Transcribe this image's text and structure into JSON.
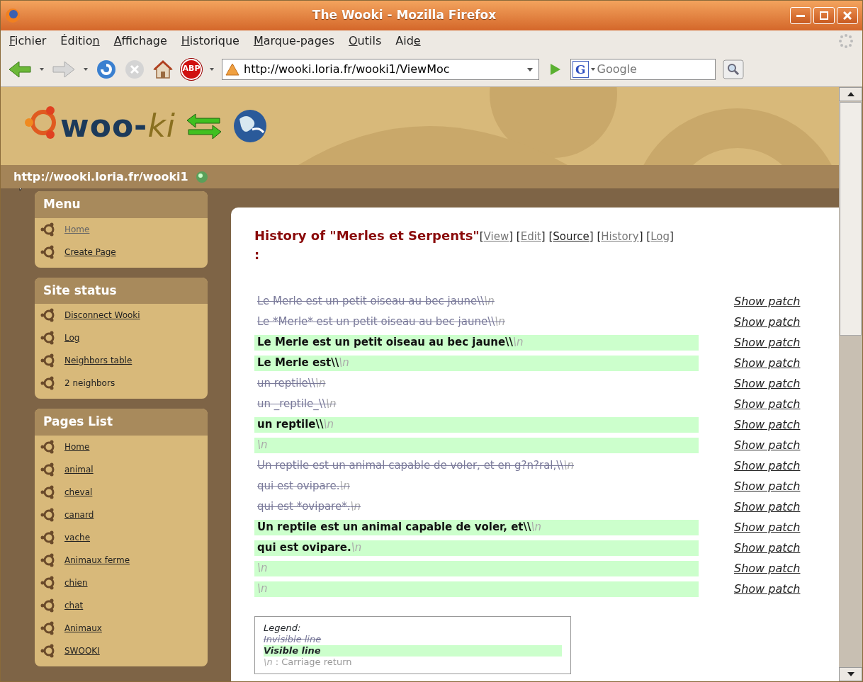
{
  "window": {
    "title": "The Wooki - Mozilla Firefox"
  },
  "menu_bar": [
    {
      "key": "F",
      "after": "ichier"
    },
    {
      "before": "Éditio",
      "key": "n"
    },
    {
      "key": "A",
      "after": "ffichage"
    },
    {
      "key": "H",
      "after": "istorique"
    },
    {
      "key": "M",
      "after": "arque-pages"
    },
    {
      "key": "O",
      "after": "utils"
    },
    {
      "before": "Aid",
      "key": "e"
    }
  ],
  "toolbar": {
    "adblock_label": "ABP",
    "url": "http://wooki.loria.fr/wooki1/ViewMoc",
    "search_engine_letter": "G",
    "search_placeholder": "Google"
  },
  "site": {
    "logo": [
      "woo-",
      "ki"
    ],
    "url": "http://wooki.loria.fr/wooki1"
  },
  "sidebar": [
    {
      "title": "Menu",
      "items": [
        {
          "label": "Home",
          "link": true,
          "visited": true
        },
        {
          "label": "Create Page",
          "link": true,
          "visited": false
        }
      ]
    },
    {
      "title": "Site status",
      "items": [
        {
          "label": "Disconnect Wooki",
          "link": true,
          "visited": false
        },
        {
          "label": "Log",
          "link": true,
          "visited": false
        },
        {
          "label": "Neighbors table",
          "link": true,
          "visited": false
        },
        {
          "label": "2 neighbors",
          "link": false,
          "visited": false
        }
      ]
    },
    {
      "title": "Pages List",
      "items": [
        {
          "label": "Home",
          "link": true,
          "visited": false
        },
        {
          "label": "animal",
          "link": true,
          "visited": false
        },
        {
          "label": "cheval",
          "link": true,
          "visited": false
        },
        {
          "label": "canard",
          "link": true,
          "visited": false
        },
        {
          "label": "vache",
          "link": true,
          "visited": false
        },
        {
          "label": "Animaux ferme",
          "link": true,
          "visited": false
        },
        {
          "label": "chien",
          "link": true,
          "visited": false
        },
        {
          "label": "chat",
          "link": true,
          "visited": false
        },
        {
          "label": "Animaux",
          "link": true,
          "visited": false
        },
        {
          "label": "SWOOKI",
          "link": true,
          "visited": false
        }
      ]
    }
  ],
  "page": {
    "title": "History of \"Merles et Serpents\"",
    "title_suffix": ":",
    "actions": [
      {
        "before": "[",
        "label": "View",
        "after": "]",
        "visited": true
      },
      {
        "before": "[",
        "label": "Edit",
        "after": "]",
        "visited": true
      },
      {
        "before": "[",
        "label": "Source",
        "after": "]",
        "visited": false
      },
      {
        "before": "[",
        "label": "History",
        "after": "]",
        "visited": true
      },
      {
        "before": "[",
        "label": "Log",
        "after": "]",
        "visited": true
      }
    ],
    "lines": [
      {
        "text": "Le Merle est un petit oiseau au bec jaune\\\\",
        "eol": "\\n",
        "visible": false,
        "patch": "Show patch"
      },
      {
        "text": "Le *Merle* est un petit oiseau au bec jaune\\\\",
        "eol": "\\n",
        "visible": false,
        "patch": "Show patch"
      },
      {
        "text": "Le Merle est un petit oiseau au bec jaune\\\\",
        "eol": "\\n",
        "visible": true,
        "patch": "Show patch"
      },
      {
        "text": "Le Merle est\\\\",
        "eol": "\\n",
        "visible": true,
        "patch": "Show patch"
      },
      {
        "text": "un reptile\\\\",
        "eol": "\\n",
        "visible": false,
        "patch": "Show patch"
      },
      {
        "text": "un _reptile_\\\\",
        "eol": "\\n",
        "visible": false,
        "patch": "Show patch"
      },
      {
        "text": "un reptile\\\\",
        "eol": "\\n",
        "visible": true,
        "patch": "Show patch"
      },
      {
        "eol": "\\n",
        "visible": true,
        "patch": "Show patch"
      },
      {
        "text": "Un reptile est un animal capable de voler, et en g?n?ral,\\\\",
        "eol": "\\n",
        "visible": false,
        "patch": "Show patch"
      },
      {
        "text": "qui est ovipare.",
        "eol": "\\n",
        "visible": false,
        "patch": "Show patch"
      },
      {
        "text": "qui est *ovipare*.",
        "eol": "\\n",
        "visible": false,
        "patch": "Show patch"
      },
      {
        "text": "Un reptile est un animal capable de voler, et\\\\",
        "eol": "\\n",
        "visible": true,
        "patch": "Show patch"
      },
      {
        "text": "qui est ovipare.",
        "eol": "\\n",
        "visible": true,
        "patch": "Show patch"
      },
      {
        "eol": "\\n",
        "visible": true,
        "patch": "Show patch"
      },
      {
        "eol": "\\n",
        "visible": true,
        "patch": "Show patch"
      }
    ],
    "legend": {
      "title": "Legend:",
      "invisible": "Invisible line",
      "visible": "Visible line",
      "eol": "\\n",
      "eol_text": " : Carriage return"
    }
  }
}
